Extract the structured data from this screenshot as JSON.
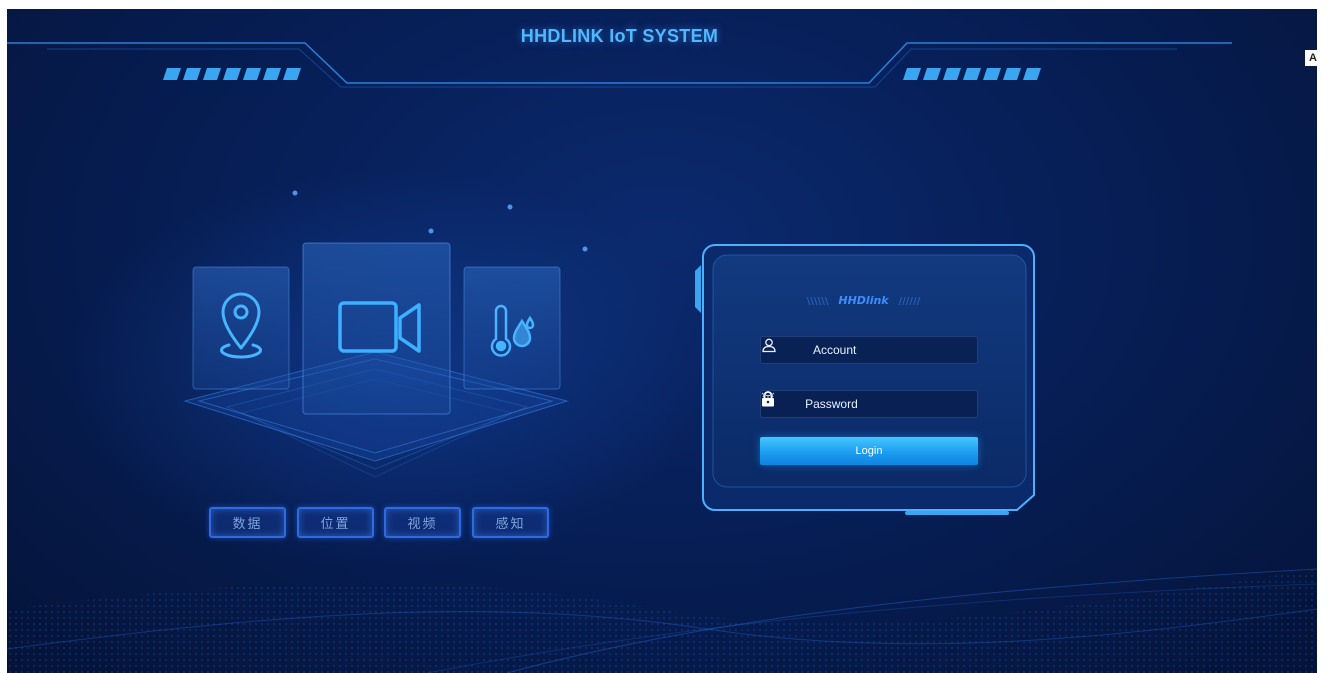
{
  "header": {
    "title": "HHDLINK IoT SYSTEM"
  },
  "translate": {
    "label": "A"
  },
  "features": {
    "tabs": [
      {
        "label": "数据"
      },
      {
        "label": "位置"
      },
      {
        "label": "视频"
      },
      {
        "label": "感知"
      }
    ]
  },
  "login": {
    "brand": "HHDlink",
    "brand_left_marks": "\\\\\\\\\\\\",
    "brand_right_marks": "//////",
    "account_placeholder": "Account",
    "password_placeholder": "Password",
    "submit_label": "Login"
  },
  "icons": {
    "account": "user-icon",
    "password": "lock-icon",
    "eye": "eye-closed-icon",
    "location": "location-pin-icon",
    "video": "video-camera-icon",
    "sensor": "thermometer-humidity-icon"
  },
  "colors": {
    "background": "#07205a",
    "accent": "#4fb8ff",
    "button": "#1c9cf0",
    "tab_border": "#2f6be0"
  }
}
